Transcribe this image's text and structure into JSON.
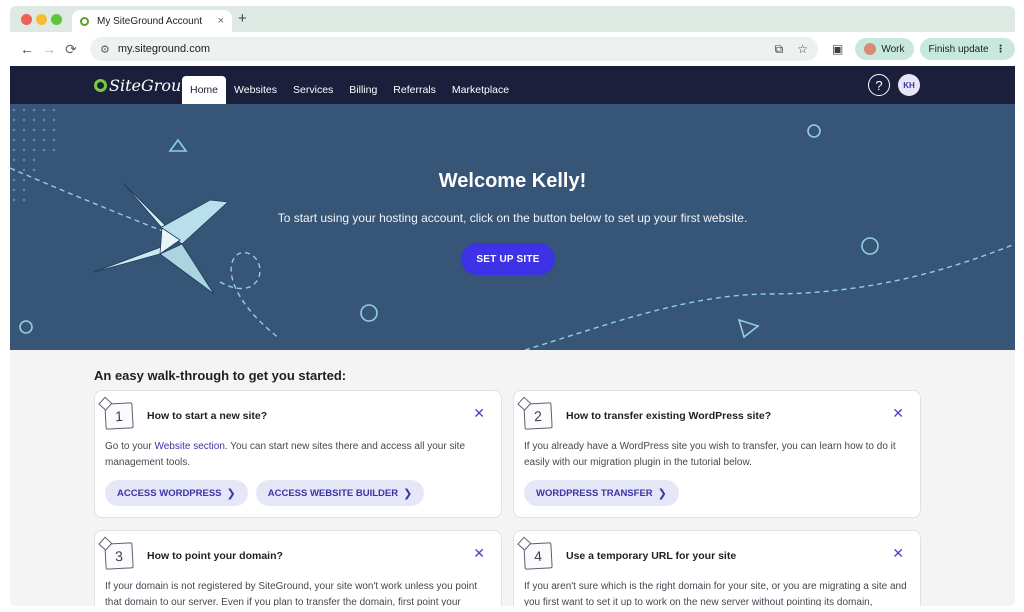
{
  "browser": {
    "tab_title": "My SiteGround Account",
    "tab_close": "×",
    "new_tab": "+",
    "url": "my.siteground.com",
    "profile_label": "Work",
    "update_label": "Finish update",
    "update_menu": "⋮",
    "icons": [
      "back-arrow-icon",
      "forward-arrow-icon",
      "reload-icon",
      "site-info-icon",
      "cast-icon",
      "star-icon",
      "extension-icon",
      "kebab-icon"
    ]
  },
  "nav": {
    "logo": "SiteGround",
    "items": [
      {
        "label": "Home",
        "active": true
      },
      {
        "label": "Websites",
        "active": false
      },
      {
        "label": "Services",
        "active": false
      },
      {
        "label": "Billing",
        "active": false
      },
      {
        "label": "Referrals",
        "active": false
      },
      {
        "label": "Marketplace",
        "active": false
      }
    ],
    "help": "?",
    "avatar_initials": "KH"
  },
  "hero": {
    "title": "Welcome Kelly!",
    "subtitle": "To start using your hosting account, click on the button below to set up your first website.",
    "cta": "SET UP SITE"
  },
  "walkthrough": {
    "heading": "An easy walk-through to get you started:",
    "cards": [
      {
        "number": "1",
        "title": "How to start a new site?",
        "text_before": "Go to your ",
        "link": "Website section",
        "text_after": ". You can start new sites there and access all your site management tools.",
        "buttons": [
          "ACCESS WORDPRESS",
          "ACCESS WEBSITE BUILDER"
        ]
      },
      {
        "number": "2",
        "title": "How to transfer existing WordPress site?",
        "text": "If you already have a WordPress site you wish to transfer, you can learn how to do it easily with our migration plugin in the tutorial below.",
        "buttons": [
          "WORDPRESS TRANSFER"
        ]
      },
      {
        "number": "3",
        "title": "How to point your domain?",
        "text": "If your domain is not registered by SiteGround, your site won't work unless you point that domain to our server. Even if you plan to transfer the domain, first point your"
      },
      {
        "number": "4",
        "title": "Use a temporary URL for your site",
        "text": "If you aren't sure which is the right domain for your site, or you are migrating a site and you first want to set it up to work on the new server without pointing its domain,"
      }
    ]
  },
  "colors": {
    "nav_bg": "#1b1f3b",
    "hero_bg": "#375576",
    "cta": "#3d32e6",
    "accent": "#3a34a6",
    "pill_bg": "#e6e7f6"
  }
}
